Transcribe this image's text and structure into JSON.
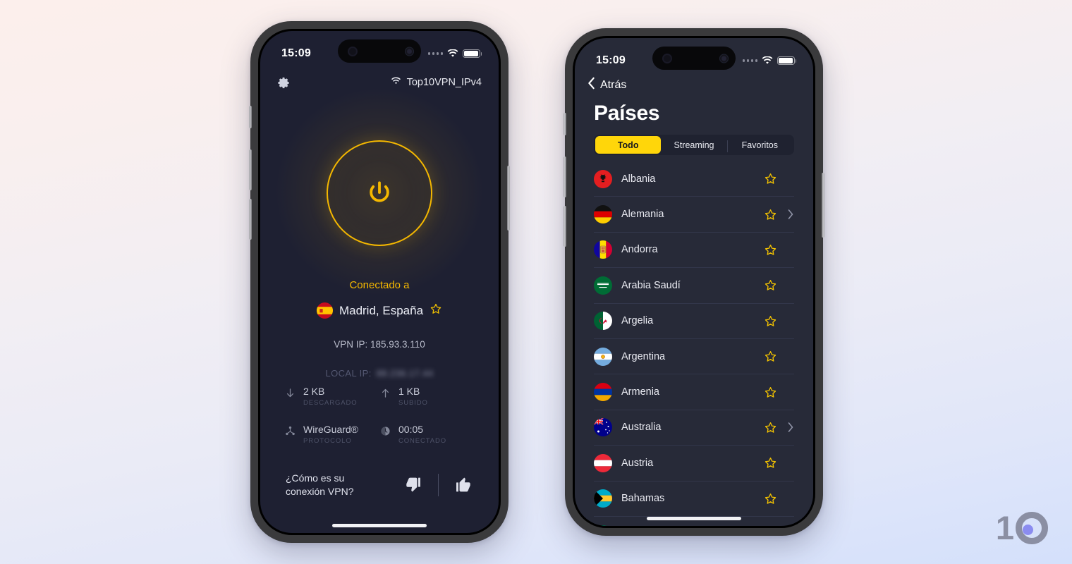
{
  "brand": {
    "text": "10",
    "color": "#8b8fa3",
    "dot_color": "#8b8cf0"
  },
  "theme": {
    "accent_yellow": "#ffd60a",
    "power_yellow": "#f5b800",
    "home_bg": "#1e2032",
    "list_bg": "#272a38",
    "tabbar_bg": "#1f2230"
  },
  "phone_left": {
    "status_bar": {
      "time": "15:09",
      "signal_icon": "signal-dots-icon",
      "wifi_icon": "wifi-icon",
      "battery_icon": "battery-icon"
    },
    "top_bar": {
      "settings_icon": "gear-icon",
      "network_icon": "wifi-icon",
      "network_name": "Top10VPN_IPv4"
    },
    "power_button": {
      "icon": "power-icon",
      "state": "connected"
    },
    "connection": {
      "status_label": "Conectado a",
      "location": "Madrid, España",
      "location_flag": "flag-es",
      "favorite_icon": "star-outline-icon",
      "vpn_ip": "VPN IP: 185.93.3.110",
      "local_ip_label": "LOCAL IP:",
      "local_ip_value": "88.236.17.44",
      "local_ip_redacted": true
    },
    "stats": [
      {
        "icon": "arrow-down-icon",
        "value": "2 KB",
        "caption": "DESCARGADO"
      },
      {
        "icon": "arrow-up-icon",
        "value": "1 KB",
        "caption": "SUBIDO"
      },
      {
        "icon": "protocol-node-icon",
        "value": "WireGuard®",
        "caption": "PROTOCOLO"
      },
      {
        "icon": "clock-icon",
        "value": "00:05",
        "caption": "CONECTADO"
      }
    ],
    "feedback": {
      "question": "¿Cómo es su\nconexión VPN?",
      "question_line1": "¿Cómo es su",
      "question_line2": "conexión VPN?",
      "thumbs_down_icon": "thumbs-down-icon",
      "thumbs_up_icon": "thumbs-up-icon"
    }
  },
  "phone_right": {
    "status_bar": {
      "time": "15:09",
      "signal_icon": "signal-dots-icon",
      "wifi_icon": "wifi-icon",
      "battery_icon": "battery-icon"
    },
    "back_label": "Atrás",
    "back_icon": "chevron-left-icon",
    "page_title": "Países",
    "tabs": [
      {
        "label": "Todo",
        "active": true
      },
      {
        "label": "Streaming",
        "active": false
      },
      {
        "label": "Favoritos",
        "active": false
      }
    ],
    "countries": [
      {
        "name": "Albania",
        "flag": "flag-al",
        "star": "star-outline-icon",
        "has_chevron": false
      },
      {
        "name": "Alemania",
        "flag": "flag-de",
        "star": "star-outline-icon",
        "has_chevron": true
      },
      {
        "name": "Andorra",
        "flag": "flag-ad",
        "star": "star-outline-icon",
        "has_chevron": false
      },
      {
        "name": "Arabia Saudí",
        "flag": "flag-sa",
        "star": "star-outline-icon",
        "has_chevron": false
      },
      {
        "name": "Argelia",
        "flag": "flag-dz",
        "star": "star-outline-icon",
        "has_chevron": false
      },
      {
        "name": "Argentina",
        "flag": "flag-ar",
        "star": "star-outline-icon",
        "has_chevron": false
      },
      {
        "name": "Armenia",
        "flag": "flag-am",
        "star": "star-outline-icon",
        "has_chevron": false
      },
      {
        "name": "Australia",
        "flag": "flag-au",
        "star": "star-outline-icon",
        "has_chevron": true
      },
      {
        "name": "Austria",
        "flag": "flag-at",
        "star": "star-outline-icon",
        "has_chevron": false
      },
      {
        "name": "Bahamas",
        "flag": "flag-bs",
        "star": "star-outline-icon",
        "has_chevron": false
      }
    ]
  }
}
